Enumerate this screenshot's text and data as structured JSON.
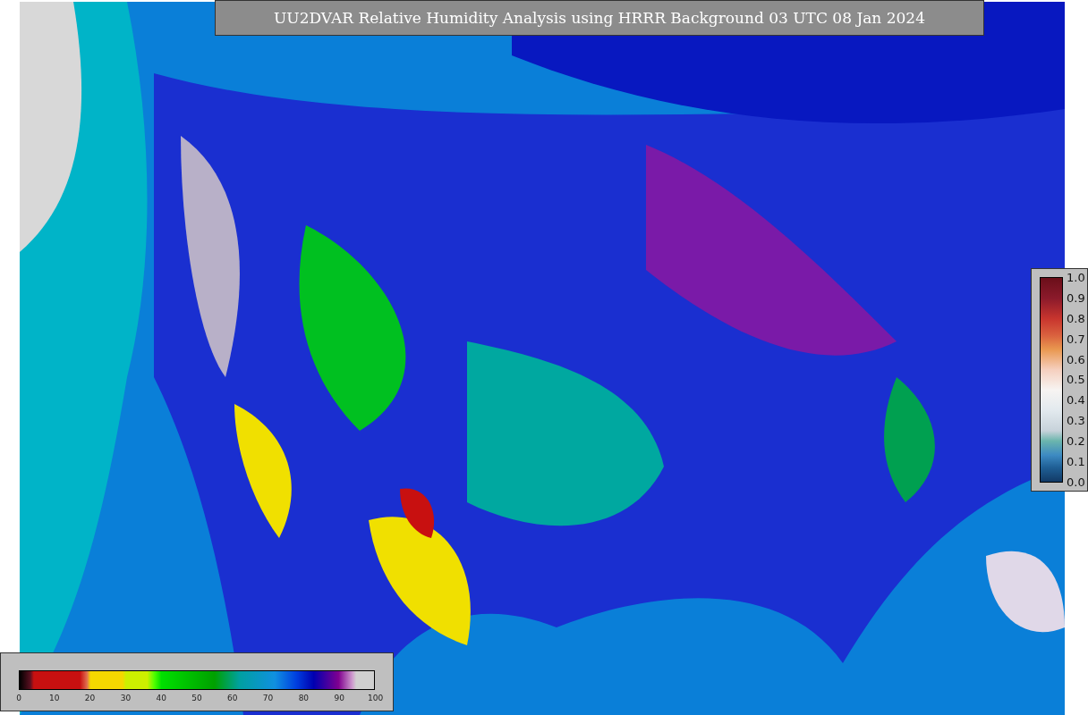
{
  "title": "UU2DVAR Relative Humidity Analysis using HRRR Background 03 UTC 08 Jan 2024",
  "ratio_legend": {
    "ticks": [
      "1.0",
      "0.9",
      "0.8",
      "0.7",
      "0.6",
      "0.5",
      "0.4",
      "0.3",
      "0.2",
      "0.1",
      "0.0"
    ]
  },
  "humidity_legend": {
    "ticks": [
      "0",
      "10",
      "20",
      "30",
      "40",
      "50",
      "60",
      "70",
      "80",
      "90",
      "100"
    ]
  }
}
